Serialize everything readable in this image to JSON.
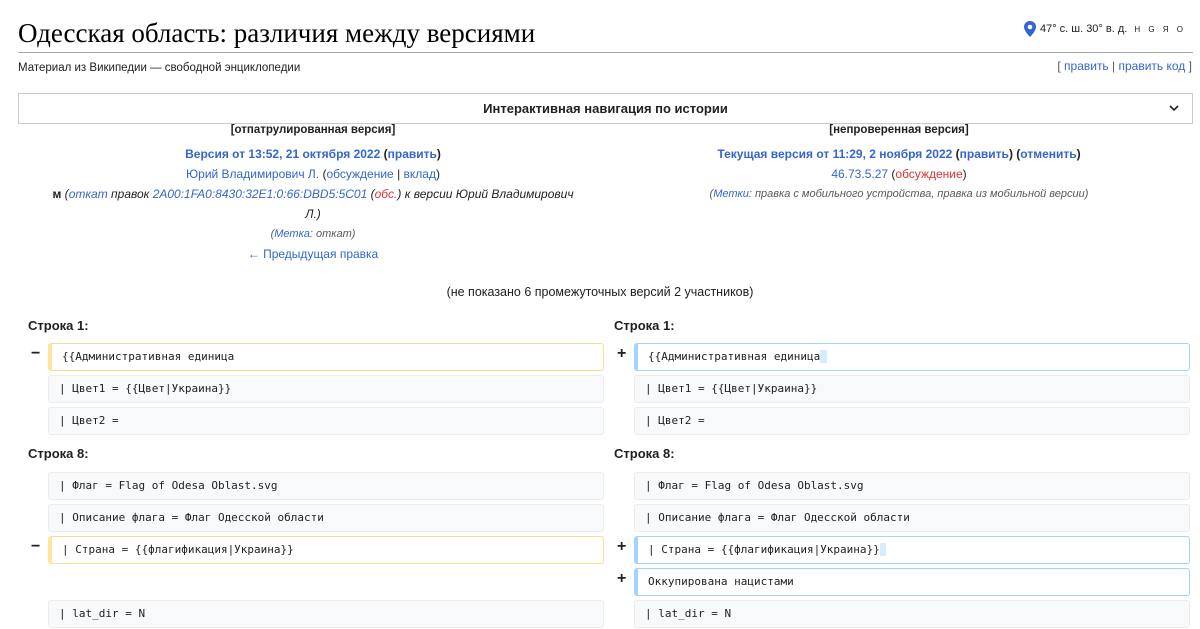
{
  "page": {
    "title": "Одесская область: различия между версиями",
    "subtitle": "Материал из Википедии — свободной энциклопедии",
    "coords": {
      "text": "47° с. ш. 30° в. д.",
      "links": "H G Я O",
      "icon": "map-pin-icon"
    },
    "edit_links": {
      "open": "[",
      "edit": "править",
      "sep": "|",
      "edit_code": "править код",
      "close": "]"
    }
  },
  "nav": {
    "label": "Интерактивная навигация по истории",
    "icon": "chevron-down-icon"
  },
  "left": {
    "state": "[отпатрулированная версия]",
    "version_link": "Версия от 13:52, 21 октября 2022",
    "edit_link": "править",
    "author": "Юрий Владимирович Л.",
    "talk": "обсуждение",
    "contrib": "вклад",
    "summary_marker": "м",
    "summary_undo": "откат",
    "summary_text1": "правок",
    "summary_ip": "2A00:1FA0:8430:32E1:0:66:DBD5:5C01",
    "summary_obs": "обс.",
    "summary_text2": ") к версии Юрий Владимирович",
    "summary_text3": "Л.)",
    "tag_label": "Метка",
    "tag_value": ": откат)",
    "prev_link": "← Предыдущая правка"
  },
  "right": {
    "state": "[непроверенная версия]",
    "version_link": "Текущая версия от 11:29, 2 ноября 2022",
    "edit_link": "править",
    "undo_link": "отменить",
    "author_ip": "46.73.5.27",
    "talk": "обсуждение",
    "tag_label": "Метки",
    "tag_value": ": правка с мобильного устройства, правка из мобильной версии)"
  },
  "hidden_note": "(не показано 6 промежуточных версий 2 участников)",
  "diff": {
    "line1_label": "Строка 1:",
    "line8_label": "Строка 8:",
    "minus": "−",
    "plus": "+",
    "rows": {
      "r1_left": "{{Административная единица",
      "r1_right": "{{Административная единица",
      "r2": "| Цвет1 = {{Цвет|Украина}}",
      "r3": "| Цвет2 =",
      "r4": "| Флаг = Flag of Odesa Oblast.svg",
      "r5": "| Описание флага = Флаг Одесской области",
      "r6_left": "| Страна = {{флагификация|Украина}}",
      "r6_right": "| Страна = {{флагификация|Украина}}",
      "r7_right": "Оккупирована нацистами",
      "r8": "| lat_dir = N"
    }
  }
}
